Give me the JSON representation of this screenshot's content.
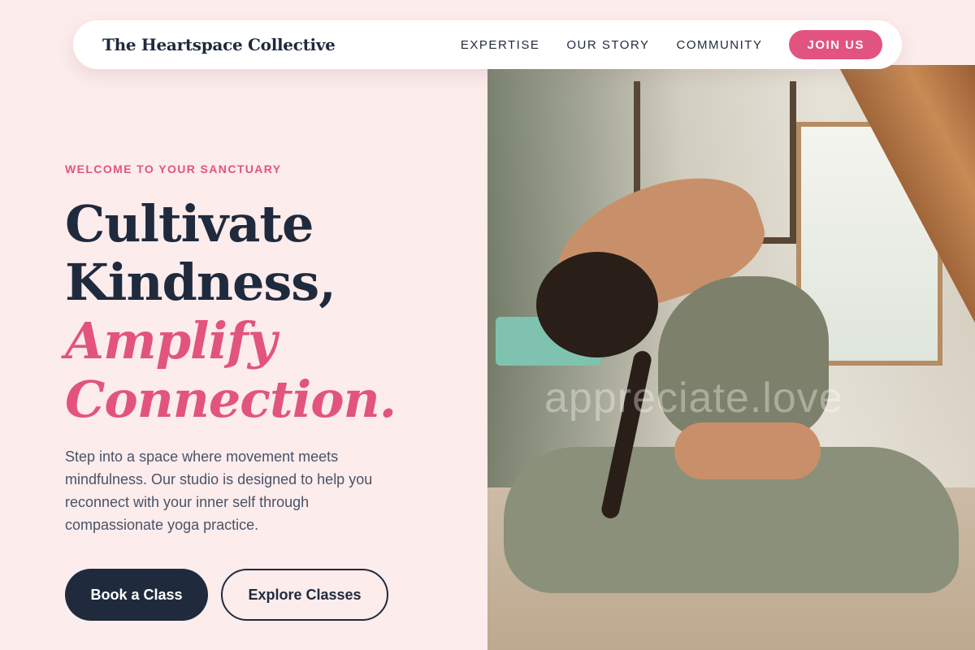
{
  "nav": {
    "brand": "The Heartspace Collective",
    "links": [
      "EXPERTISE",
      "OUR STORY",
      "COMMUNITY"
    ],
    "cta": "JOIN US"
  },
  "hero": {
    "eyebrow": "WELCOME TO YOUR SANCTUARY",
    "headline_line1": "Cultivate",
    "headline_line2": "Kindness,",
    "headline_line3": "Amplify",
    "headline_line4": "Connection.",
    "lede": "Step into a space where movement meets mindfulness. Our studio is designed to help you reconnect with your inner self through compassionate yoga practice.",
    "primary_cta": "Book a Class",
    "secondary_cta": "Explore Classes",
    "image_watermark": "appreciate.love"
  },
  "colors": {
    "background": "#fcecec",
    "accent": "#e2547f",
    "navy": "#1f2a3d"
  }
}
